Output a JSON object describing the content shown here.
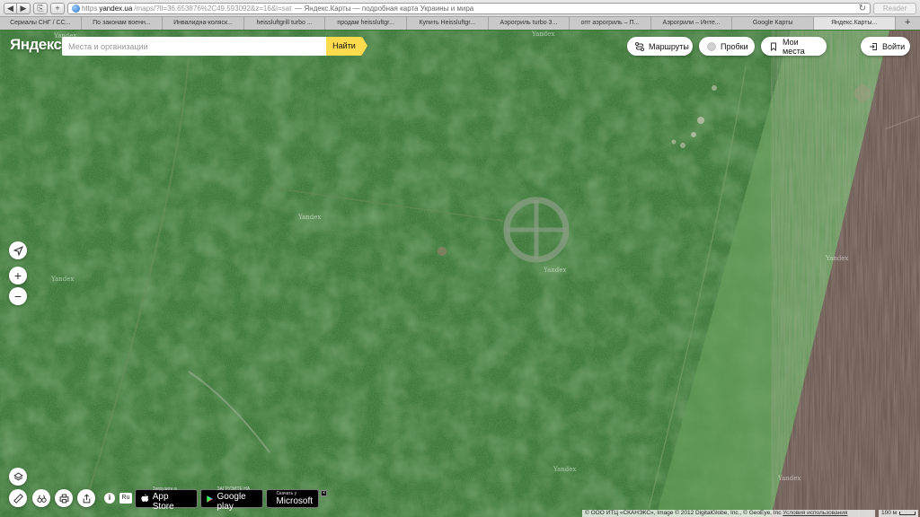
{
  "browser": {
    "nav_back": "◀",
    "nav_forward": "▶",
    "share": "⎘",
    "add": "+",
    "url_scheme": "https",
    "url_host": "yandex.ua",
    "url_path": "/maps/?ll=36.653876%2C49.593092&z=16&l=sat",
    "url_title": "— Яндекс.Карты — подробная карта Украины и мира",
    "reload": "↻",
    "reader": "Reader",
    "tabs": [
      {
        "label": "Сериалы СНГ / СС..."
      },
      {
        "label": "По законам военн..."
      },
      {
        "label": "Инвалидна-коляск..."
      },
      {
        "label": "heissluftgrill turbo ..."
      },
      {
        "label": "продам heissluftgr..."
      },
      {
        "label": "Купить Heissluftgr..."
      },
      {
        "label": "Аэрогриль turbo 3..."
      },
      {
        "label": "опт аэрогриль – П..."
      },
      {
        "label": "Аэрогрили – Инте..."
      },
      {
        "label": "Google Карты"
      },
      {
        "label": "Яндекс.Карты..."
      }
    ],
    "new_tab": "+"
  },
  "header": {
    "logo": "Яндекс",
    "search_placeholder": "Места и организации",
    "search_button": "Найти",
    "routes": "Маршруты",
    "traffic": "Пробки",
    "my_places": "Мои места",
    "login": "Войти"
  },
  "controls": {
    "zoom_in": "+",
    "zoom_out": "−",
    "info": "i",
    "lang": "Ru"
  },
  "stores": {
    "appstore_small": "Загрузите в",
    "appstore_big": "App Store",
    "googleplay_small": "ЗАГРУЗИТЕ НА",
    "googleplay_big": "Google play",
    "microsoft_small": "Скачать у",
    "microsoft_big": "Microsoft",
    "close": "×"
  },
  "map": {
    "watermarks": [
      "Yandex",
      "Yandex",
      "Yandex",
      "Yandex",
      "Yandex",
      "Yandex",
      "Yandex",
      "Yandex"
    ]
  },
  "footer": {
    "copyright": "© ООО ИТЦ «СКАНЭКС», Image © 2012 DigitalGlobe, Inc., © GeoEye, Inc",
    "terms": "Условия использования",
    "scale": "100 м"
  },
  "colors": {
    "accent": "#ffdb4d",
    "field_green": "#3f7a3a",
    "plowed": "#6b5a52"
  }
}
